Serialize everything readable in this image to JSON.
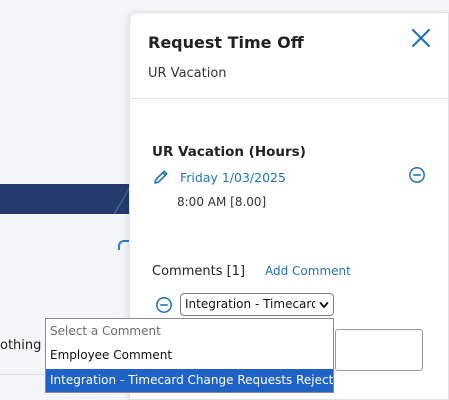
{
  "background": {
    "partial_text": "othing"
  },
  "panel": {
    "title": "Request Time Off",
    "subtitle": "UR Vacation",
    "close_icon": "close-icon",
    "section_title": "UR Vacation (Hours)",
    "date_link": "Friday 1/03/2025",
    "time": "8:00 AM [8.00]",
    "comments_label": "Comments [1]",
    "add_comment": "Add Comment",
    "selected_comment": "Integration - Timecard Change Requests Rejection",
    "dropdown_options": [
      "Select a Comment",
      "Employee Comment",
      "Integration - Timecard Change Requests Rejection"
    ],
    "highlighted_option_index": 2
  },
  "colors": {
    "accent": "#1f73b7",
    "highlight": "#1f63c6",
    "nav_band": "#243a6b"
  }
}
